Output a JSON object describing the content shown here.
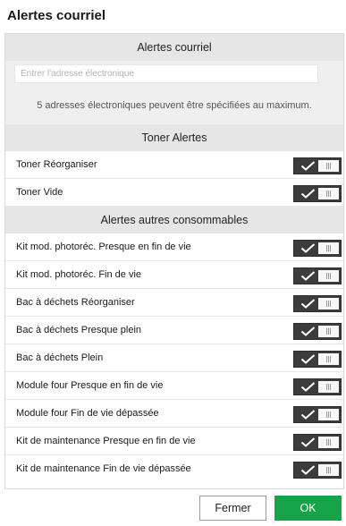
{
  "window": {
    "title": "Alertes courriel"
  },
  "email_section": {
    "header": "Alertes courriel",
    "input_placeholder": "Entrer l'adresse électronique",
    "input_value": "",
    "note": "5 adresses électroniques peuvent être spécifiées au maximum."
  },
  "toner_section": {
    "header": "Toner Alertes",
    "items": [
      {
        "label": "Toner Réorganiser",
        "enabled": true
      },
      {
        "label": "Toner Vide",
        "enabled": true
      }
    ]
  },
  "supplies_section": {
    "header": "Alertes autres consommables",
    "items": [
      {
        "label": "Kit mod. photoréc. Presque en fin de vie",
        "enabled": true
      },
      {
        "label": "Kit mod. photoréc. Fin de vie",
        "enabled": true
      },
      {
        "label": "Bac à déchets Réorganiser",
        "enabled": true
      },
      {
        "label": "Bac à déchets Presque plein",
        "enabled": true
      },
      {
        "label": "Bac à déchets Plein",
        "enabled": true
      },
      {
        "label": "Module four Presque en fin de vie",
        "enabled": true
      },
      {
        "label": "Module four Fin de vie dépassée",
        "enabled": true
      },
      {
        "label": "Kit de maintenance Presque en fin de vie",
        "enabled": true
      },
      {
        "label": "Kit de maintenance Fin de vie dépassée",
        "enabled": true
      }
    ]
  },
  "footer": {
    "close_label": "Fermer",
    "ok_label": "OK"
  },
  "colors": {
    "section_bg": "#e6e6e6",
    "toggle_on": "#3c3c3c",
    "ok_button": "#16a34a"
  }
}
